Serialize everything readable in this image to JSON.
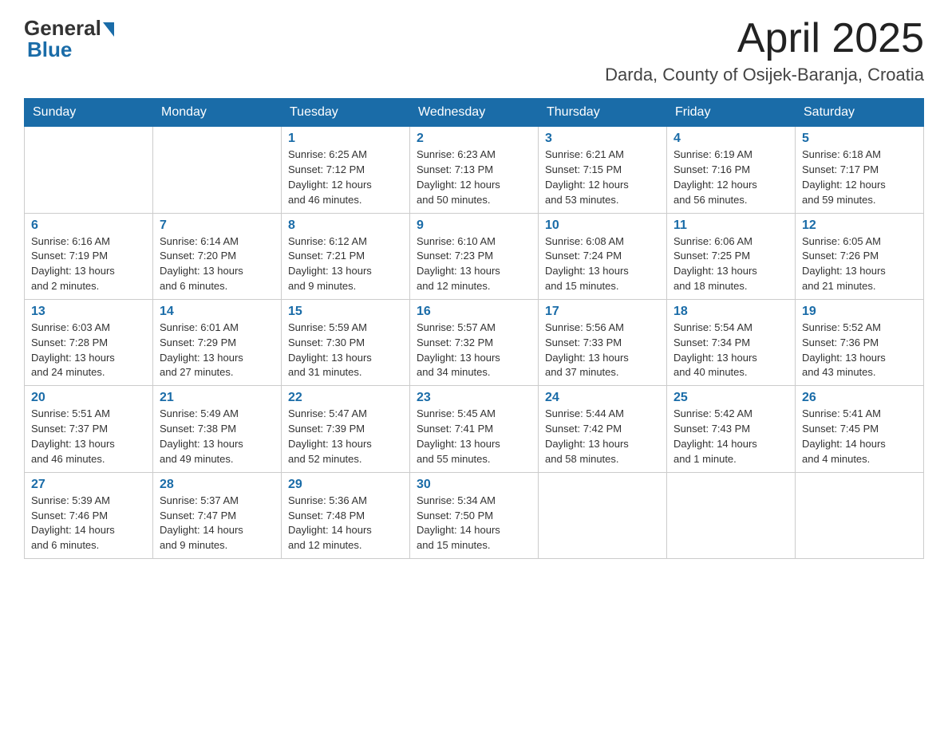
{
  "logo": {
    "general": "General",
    "blue": "Blue"
  },
  "title": {
    "month_year": "April 2025",
    "location": "Darda, County of Osijek-Baranja, Croatia"
  },
  "weekdays": [
    "Sunday",
    "Monday",
    "Tuesday",
    "Wednesday",
    "Thursday",
    "Friday",
    "Saturday"
  ],
  "weeks": [
    [
      {
        "day": "",
        "info": ""
      },
      {
        "day": "",
        "info": ""
      },
      {
        "day": "1",
        "info": "Sunrise: 6:25 AM\nSunset: 7:12 PM\nDaylight: 12 hours\nand 46 minutes."
      },
      {
        "day": "2",
        "info": "Sunrise: 6:23 AM\nSunset: 7:13 PM\nDaylight: 12 hours\nand 50 minutes."
      },
      {
        "day": "3",
        "info": "Sunrise: 6:21 AM\nSunset: 7:15 PM\nDaylight: 12 hours\nand 53 minutes."
      },
      {
        "day": "4",
        "info": "Sunrise: 6:19 AM\nSunset: 7:16 PM\nDaylight: 12 hours\nand 56 minutes."
      },
      {
        "day": "5",
        "info": "Sunrise: 6:18 AM\nSunset: 7:17 PM\nDaylight: 12 hours\nand 59 minutes."
      }
    ],
    [
      {
        "day": "6",
        "info": "Sunrise: 6:16 AM\nSunset: 7:19 PM\nDaylight: 13 hours\nand 2 minutes."
      },
      {
        "day": "7",
        "info": "Sunrise: 6:14 AM\nSunset: 7:20 PM\nDaylight: 13 hours\nand 6 minutes."
      },
      {
        "day": "8",
        "info": "Sunrise: 6:12 AM\nSunset: 7:21 PM\nDaylight: 13 hours\nand 9 minutes."
      },
      {
        "day": "9",
        "info": "Sunrise: 6:10 AM\nSunset: 7:23 PM\nDaylight: 13 hours\nand 12 minutes."
      },
      {
        "day": "10",
        "info": "Sunrise: 6:08 AM\nSunset: 7:24 PM\nDaylight: 13 hours\nand 15 minutes."
      },
      {
        "day": "11",
        "info": "Sunrise: 6:06 AM\nSunset: 7:25 PM\nDaylight: 13 hours\nand 18 minutes."
      },
      {
        "day": "12",
        "info": "Sunrise: 6:05 AM\nSunset: 7:26 PM\nDaylight: 13 hours\nand 21 minutes."
      }
    ],
    [
      {
        "day": "13",
        "info": "Sunrise: 6:03 AM\nSunset: 7:28 PM\nDaylight: 13 hours\nand 24 minutes."
      },
      {
        "day": "14",
        "info": "Sunrise: 6:01 AM\nSunset: 7:29 PM\nDaylight: 13 hours\nand 27 minutes."
      },
      {
        "day": "15",
        "info": "Sunrise: 5:59 AM\nSunset: 7:30 PM\nDaylight: 13 hours\nand 31 minutes."
      },
      {
        "day": "16",
        "info": "Sunrise: 5:57 AM\nSunset: 7:32 PM\nDaylight: 13 hours\nand 34 minutes."
      },
      {
        "day": "17",
        "info": "Sunrise: 5:56 AM\nSunset: 7:33 PM\nDaylight: 13 hours\nand 37 minutes."
      },
      {
        "day": "18",
        "info": "Sunrise: 5:54 AM\nSunset: 7:34 PM\nDaylight: 13 hours\nand 40 minutes."
      },
      {
        "day": "19",
        "info": "Sunrise: 5:52 AM\nSunset: 7:36 PM\nDaylight: 13 hours\nand 43 minutes."
      }
    ],
    [
      {
        "day": "20",
        "info": "Sunrise: 5:51 AM\nSunset: 7:37 PM\nDaylight: 13 hours\nand 46 minutes."
      },
      {
        "day": "21",
        "info": "Sunrise: 5:49 AM\nSunset: 7:38 PM\nDaylight: 13 hours\nand 49 minutes."
      },
      {
        "day": "22",
        "info": "Sunrise: 5:47 AM\nSunset: 7:39 PM\nDaylight: 13 hours\nand 52 minutes."
      },
      {
        "day": "23",
        "info": "Sunrise: 5:45 AM\nSunset: 7:41 PM\nDaylight: 13 hours\nand 55 minutes."
      },
      {
        "day": "24",
        "info": "Sunrise: 5:44 AM\nSunset: 7:42 PM\nDaylight: 13 hours\nand 58 minutes."
      },
      {
        "day": "25",
        "info": "Sunrise: 5:42 AM\nSunset: 7:43 PM\nDaylight: 14 hours\nand 1 minute."
      },
      {
        "day": "26",
        "info": "Sunrise: 5:41 AM\nSunset: 7:45 PM\nDaylight: 14 hours\nand 4 minutes."
      }
    ],
    [
      {
        "day": "27",
        "info": "Sunrise: 5:39 AM\nSunset: 7:46 PM\nDaylight: 14 hours\nand 6 minutes."
      },
      {
        "day": "28",
        "info": "Sunrise: 5:37 AM\nSunset: 7:47 PM\nDaylight: 14 hours\nand 9 minutes."
      },
      {
        "day": "29",
        "info": "Sunrise: 5:36 AM\nSunset: 7:48 PM\nDaylight: 14 hours\nand 12 minutes."
      },
      {
        "day": "30",
        "info": "Sunrise: 5:34 AM\nSunset: 7:50 PM\nDaylight: 14 hours\nand 15 minutes."
      },
      {
        "day": "",
        "info": ""
      },
      {
        "day": "",
        "info": ""
      },
      {
        "day": "",
        "info": ""
      }
    ]
  ]
}
